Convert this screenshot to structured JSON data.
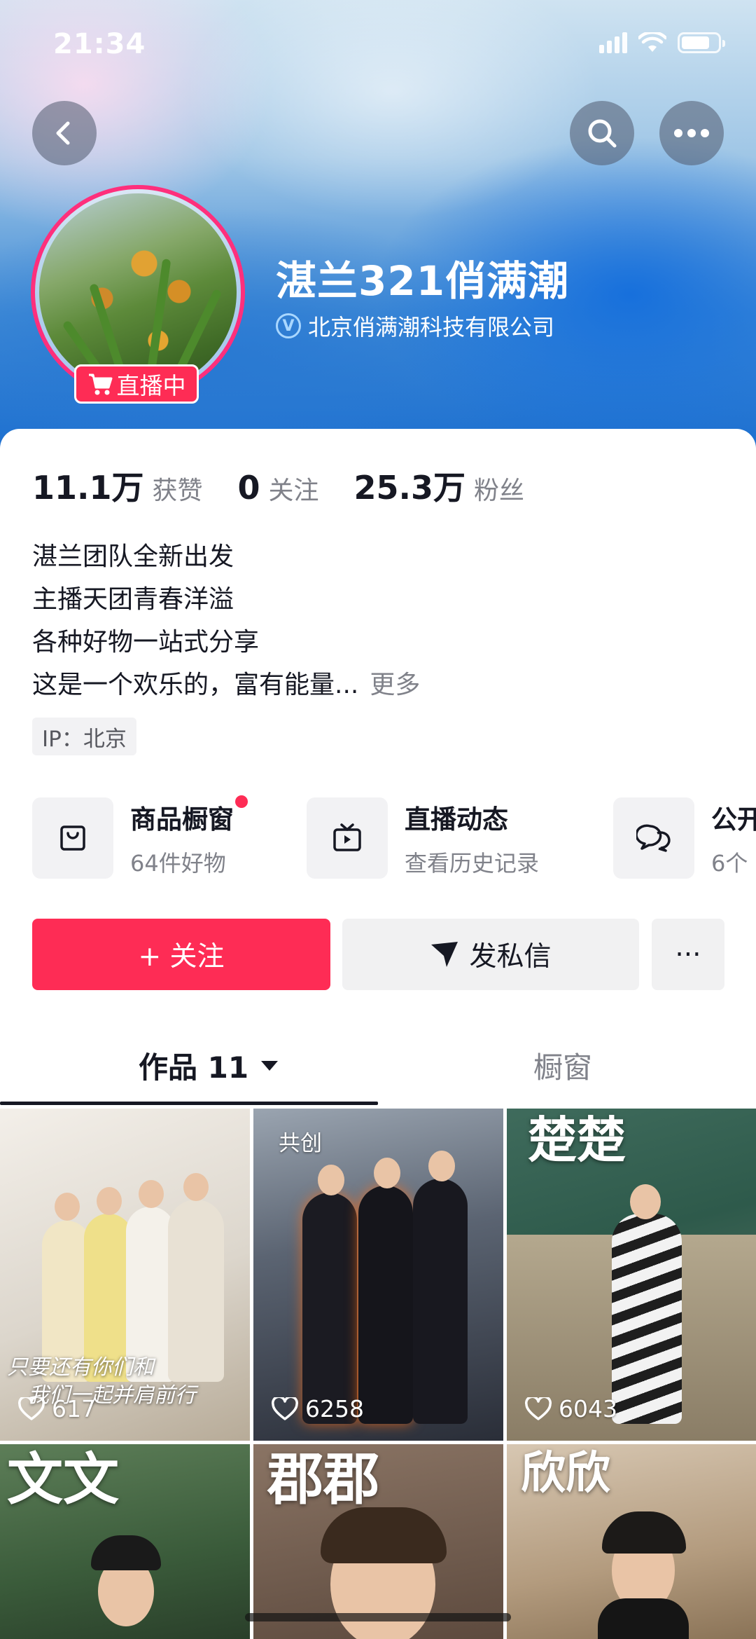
{
  "status_bar": {
    "time": "21:34"
  },
  "profile": {
    "name": "湛兰321俏满潮",
    "verified_org": "北京俏满潮科技有限公司",
    "live_badge": "直播中",
    "stats": [
      {
        "num": "11.1万",
        "label": "获赞"
      },
      {
        "num": "0",
        "label": "关注"
      },
      {
        "num": "25.3万",
        "label": "粉丝"
      }
    ],
    "bio_lines": [
      "湛兰团队全新出发",
      "主播天团青春洋溢",
      "各种好物一站式分享",
      "这是一个欢乐的，富有能量..."
    ],
    "bio_more": "更多",
    "ip": "IP：北京"
  },
  "features": [
    {
      "title": "商品橱窗",
      "sub": "64件好物",
      "icon": "bag-icon"
    },
    {
      "title": "直播动态",
      "sub": "查看历史记录",
      "icon": "tv-icon"
    },
    {
      "title": "公开",
      "sub": "6个",
      "icon": "chat-icon"
    }
  ],
  "actions": {
    "follow": "+ 关注",
    "message": "发私信",
    "more": "···"
  },
  "tabs": {
    "works": "作品 11",
    "window": "橱窗"
  },
  "grid": [
    {
      "likes": "617",
      "caption1": "只要还有你们和",
      "caption2": "我们一起并肩前行"
    },
    {
      "likes": "6258",
      "tag": "共创"
    },
    {
      "likes": "6043",
      "calligraphy": "楚楚"
    },
    {
      "calligraphy": "文文"
    },
    {
      "calligraphy": "郡郡"
    },
    {
      "calligraphy": "欣欣"
    }
  ]
}
